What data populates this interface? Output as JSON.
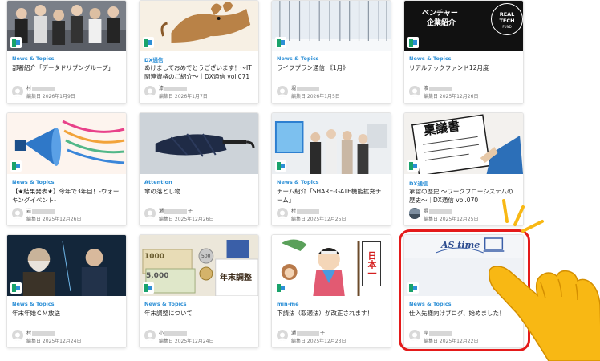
{
  "colors": {
    "category": "#2c8fd6",
    "highlight": "#e41a1a",
    "hand": "#f8b814"
  },
  "cards": [
    {
      "category": "News & Topics",
      "title": "部署紹介「データドリブングループ」",
      "author_prefix": "村",
      "author_suffix": "",
      "date": "編集日 2026年1月9日"
    },
    {
      "category": "DX通信",
      "title": "あけましておめでとうございます！～IT関連資格のご紹介～｜DX通信 vol.071",
      "author_prefix": "漆",
      "author_suffix": "",
      "date": "編集日 2026年1月7日"
    },
    {
      "category": "News & Topics",
      "title": "ライフプラン通信 《1月》",
      "author_prefix": "堀",
      "author_suffix": "",
      "date": "編集日 2026年1月5日"
    },
    {
      "category": "News & Topics",
      "title": "リアルテックファンド12月度",
      "author_prefix": "濱",
      "author_suffix": "",
      "date": "編集日 2025年12月26日",
      "thumb_text_1": "ベンチャー",
      "thumb_text_2": "企業紹介",
      "logo_line_1": "REAL",
      "logo_line_2": "TECH",
      "logo_line_3": "FUND"
    },
    {
      "category": "News & Topics",
      "title": "【★結果発表★】今年で3年目！-ウォーキングイベント-",
      "author_prefix": "岩",
      "author_suffix": "",
      "date": "編集日 2025年12月26日"
    },
    {
      "category": "Attention",
      "title": "傘の落とし物",
      "author_prefix": "瀬",
      "author_suffix": "子",
      "date": "編集日 2025年12月26日"
    },
    {
      "category": "News & Topics",
      "title": "チーム紹介「SHARE-GATE機能拡充チーム」",
      "author_prefix": "村",
      "author_suffix": "",
      "date": "編集日 2025年12月25日"
    },
    {
      "category": "DX通信",
      "title": "承認の歴史 ～ワークフローシステムの歴史～｜DX通信 vol.070",
      "author_prefix": "堀",
      "author_suffix": "",
      "date": "編集日 2025年12月25日",
      "thumb_text_1": "稟議書"
    },
    {
      "category": "News & Topics",
      "title": "年末年始ＣＭ放送",
      "author_prefix": "村",
      "author_suffix": "",
      "date": "編集日 2025年12月24日"
    },
    {
      "category": "News & Topics",
      "title": "年末調整について",
      "author_prefix": "小",
      "author_suffix": "",
      "date": "編集日 2025年12月24日",
      "thumb_text_1": "年末調整",
      "thumb_text_2": "5,000",
      "thumb_text_3": "1000",
      "thumb_text_4": "500"
    },
    {
      "category": "min-me",
      "title": "下請法（取適法）が改正されます！",
      "author_prefix": "瀬",
      "author_suffix": "子",
      "date": "編集日 2025年12月23日",
      "thumb_text_1": "日本一"
    },
    {
      "category": "News & Topics",
      "title": "仕入先様向けブログ、始めました！",
      "author_prefix": "岸",
      "author_suffix": "",
      "date": "編集日 2025年12月22日",
      "thumb_text_1": "AS time"
    }
  ]
}
